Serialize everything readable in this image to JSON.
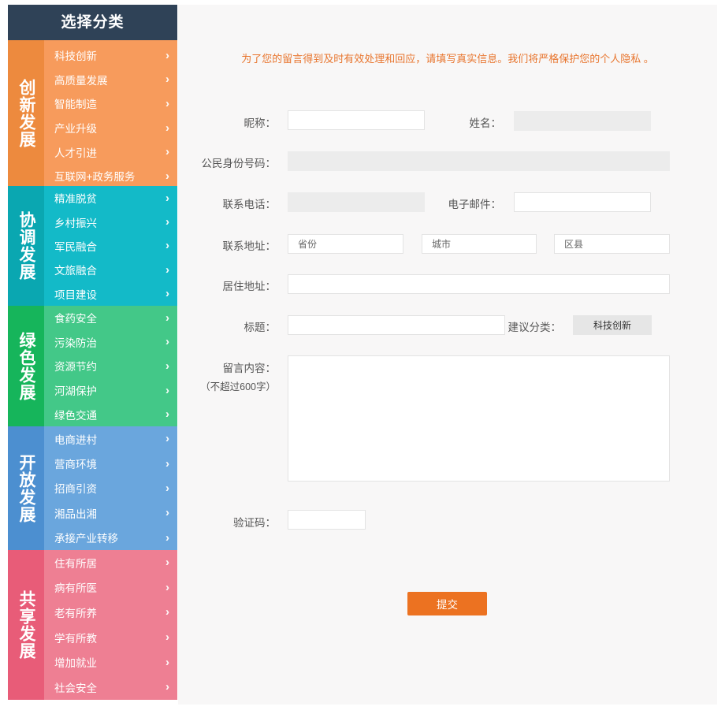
{
  "sidebar": {
    "header": "选择分类",
    "chevron": "›",
    "groups": [
      {
        "title": "创新发展",
        "items": [
          "科技创新",
          "高质量发展",
          "智能制造",
          "产业升级",
          "人才引进",
          "互联网+政务服务"
        ]
      },
      {
        "title": "协调发展",
        "items": [
          "精准脱贫",
          "乡村振兴",
          "军民融合",
          "文旅融合",
          "项目建设"
        ]
      },
      {
        "title": "绿色发展",
        "items": [
          "食药安全",
          "污染防治",
          "资源节约",
          "河湖保护",
          "绿色交通"
        ]
      },
      {
        "title": "开放发展",
        "items": [
          "电商进村",
          "营商环境",
          "招商引资",
          "湘品出湘",
          "承接产业转移"
        ]
      },
      {
        "title": "共享发展",
        "items": [
          "住有所居",
          "病有所医",
          "老有所养",
          "学有所教",
          "增加就业",
          "社会安全"
        ]
      }
    ]
  },
  "form": {
    "notice": "为了您的留言得到及时有效处理和回应，请填写真实信息。我们将严格保护您的个人隐私 。",
    "labels": {
      "nickname": "昵称：",
      "name": "姓名：",
      "id_number": "公民身份号码：",
      "phone": "联系电话：",
      "email": "电子邮件：",
      "address": "联系地址：",
      "residence": "居住地址：",
      "subject": "标题：",
      "category": "建议分类：",
      "content": "留言内容：",
      "content_hint": "（不超过600字）",
      "captcha": "验证码："
    },
    "placeholders": {
      "province": "省份",
      "city": "城市",
      "county": "区县"
    },
    "category_value": "科技创新",
    "submit": "提交"
  }
}
